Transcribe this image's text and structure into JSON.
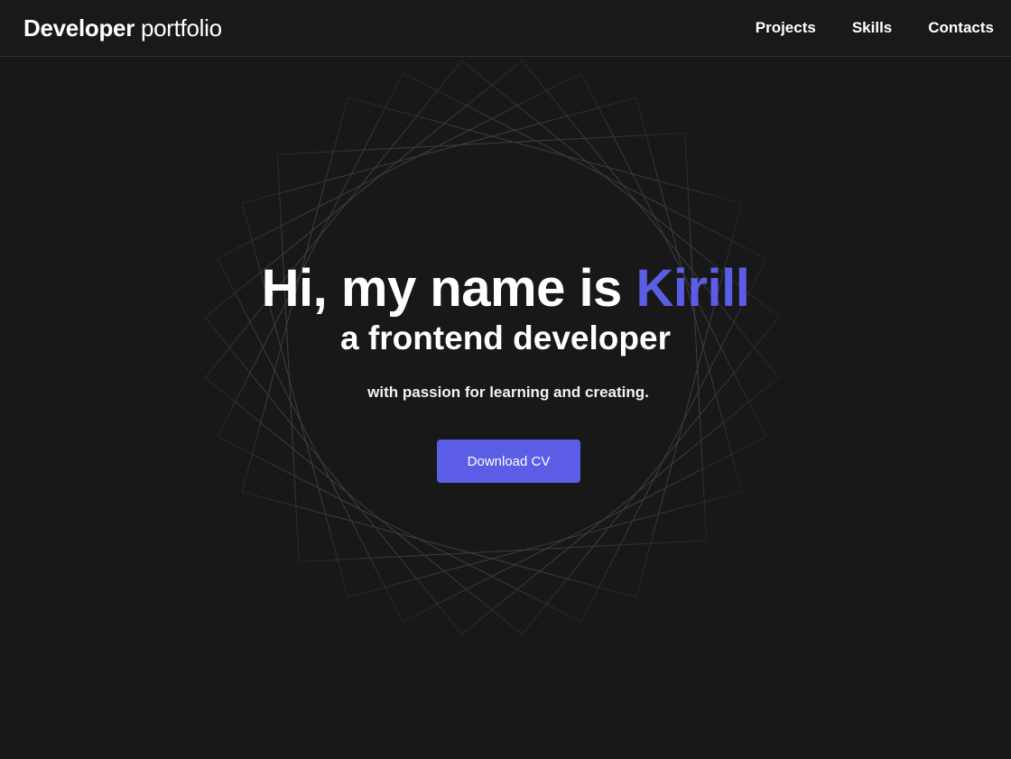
{
  "header": {
    "logo_bold": "Developer",
    "logo_light": " portfolio",
    "nav": [
      {
        "label": "Projects"
      },
      {
        "label": "Skills"
      },
      {
        "label": "Contacts"
      }
    ]
  },
  "hero": {
    "title_prefix": "Hi, my name is ",
    "name": "Kirill",
    "subtitle": "a frontend developer",
    "tagline": "with passion for learning and creating.",
    "cta_label": "Download CV"
  },
  "colors": {
    "background": "#181819",
    "accent": "#5b5de6",
    "text": "#ffffff",
    "outline": "#3a3a3d"
  }
}
